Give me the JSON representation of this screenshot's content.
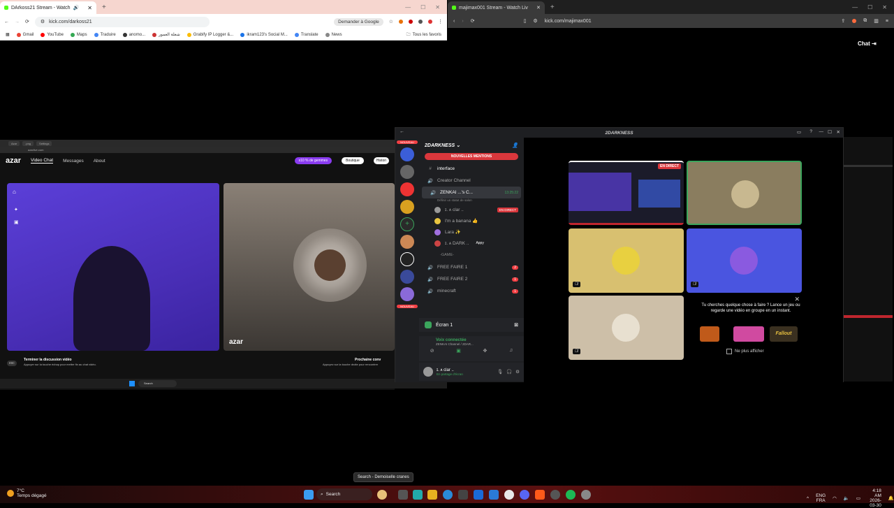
{
  "left_browser": {
    "tab_title": "DArkoss21 Stream - Watch",
    "url": "kick.com/darkoss21",
    "ask_google": "Demander à Google",
    "bookmarks": [
      "Gmail",
      "YouTube",
      "Maps",
      "Traduire",
      "anomo...",
      "شعلة العمور",
      "Grabify IP Logger &...",
      "ikram123's Social M...",
      "Translate",
      "News"
    ],
    "all_bookmarks": "Tous les favoris"
  },
  "azar": {
    "logo": "azar",
    "nav": [
      "Video Chat",
      "Messages",
      "About"
    ],
    "gems": "x10 % de gemmes",
    "boutique": "Boutique",
    "history": "Histori",
    "watermark": "azar",
    "end_title": "Terminer la discussion vidéo",
    "end_sub": "Appuyer sur la touche échap pour mettre fin au chat vidéo.",
    "next_title": "Prochaine conv",
    "next_sub": "Appuyez sur la touche droite pour rencontrer",
    "esc": "esc",
    "mini_search": "Search"
  },
  "right_browser": {
    "tab_title": "majimax001 Stream - Watch Liv",
    "url": "kick.com/majimax001",
    "chat_label": "Chat"
  },
  "discord": {
    "window_title": "2DARKNESS",
    "server_name": "2DARKNESS",
    "mentions_banner": "NOUVELLES MENTIONS",
    "new_label": "NOUVEAU",
    "channels": [
      {
        "name": "interface",
        "icon": "#"
      },
      {
        "name": "Creator Channel",
        "icon": "+"
      },
      {
        "name": "ZENKAI ...'s C...",
        "icon": "🔊",
        "time": "13:25:22",
        "status": "Définir un statut de salon"
      }
    ],
    "voice_users": [
      {
        "name": "ɪ. ᴀ clar ..",
        "live": "EN DIRECT"
      },
      {
        "name": "I'm a banana 👍"
      },
      {
        "name": "Lara ✨"
      },
      {
        "name": "ɪ. ᴀ DARK ..",
        "tag": "Appy"
      }
    ],
    "category": "-GAME-",
    "game_channels": [
      {
        "name": "FREE FAIRE 1",
        "badge": "2"
      },
      {
        "name": "FREE FAIRE 2",
        "badge": "1"
      },
      {
        "name": "minecraft",
        "badge": "1"
      }
    ],
    "screen_share": "Écran 1",
    "voice_connected": "Voix connectée",
    "voice_channel": "ZENKAI Channel / 2DAR...",
    "user_name": "ɪ. ᴀ clar ..",
    "user_status": "En partage d'écran",
    "live_badge": "EN DIRECT",
    "activity_title": "Tu cherches quelque chose à faire ? Lance un jeu ou regarde une vidéo en groupe en un instant.",
    "dont_show": "Ne plus afficher",
    "game_tile": "Fallout"
  },
  "taskbar": {
    "weather_temp": "7°C",
    "weather_desc": "Temps dégagé",
    "search": "Search",
    "tooltip": "Search - Demoiselle cranes",
    "lang1": "ENG",
    "lang2": "FRA",
    "time": "4:18 AM",
    "date": "2026-03-30"
  }
}
